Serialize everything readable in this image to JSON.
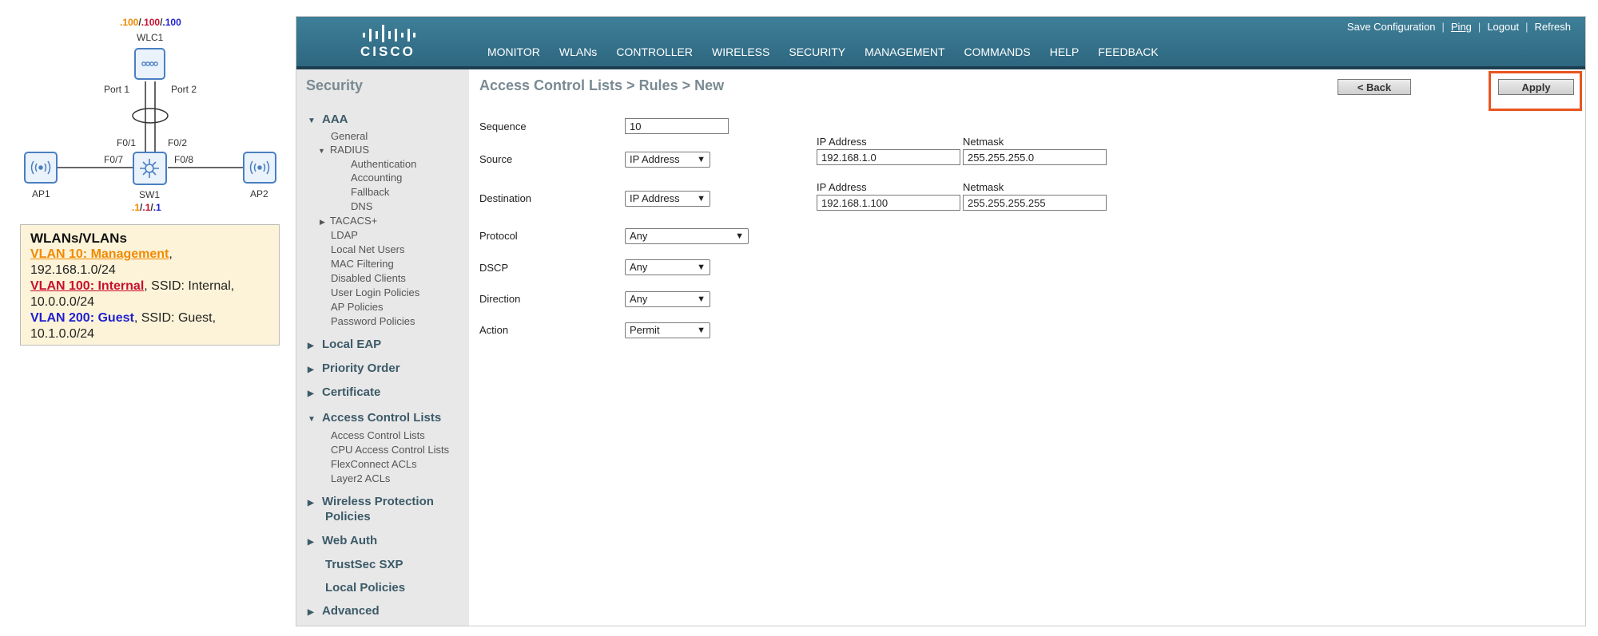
{
  "topology": {
    "wlc_ips": [
      ".100",
      "/",
      ".100",
      "/",
      ".100"
    ],
    "wlc_name": "WLC1",
    "port1": "Port 1",
    "port2": "Port 2",
    "f01": "F0/1",
    "f02": "F0/2",
    "f07": "F0/7",
    "f08": "F0/8",
    "ap1": "AP1",
    "ap2": "AP2",
    "sw_name": "SW1",
    "sw_ips": [
      ".1",
      "/",
      ".1",
      "/",
      ".1"
    ]
  },
  "legend": {
    "title": "WLANs/VLANs",
    "vlan10_name": "VLAN 10: Management",
    "vlan10_rest": ",",
    "vlan10_net": "192.168.1.0/24",
    "vlan100_name": "VLAN 100: Internal",
    "vlan100_rest": ", SSID: Internal,",
    "vlan100_net": "10.0.0.0/24",
    "vlan200_name": "VLAN 200: Guest",
    "vlan200_rest": ", SSID: Guest,",
    "vlan200_net": "10.1.0.0/24"
  },
  "header": {
    "logo_text": "CISCO",
    "toplinks": [
      "Save Configuration",
      "Ping",
      "Logout",
      "Refresh"
    ],
    "nav": [
      "MONITOR",
      "WLANs",
      "CONTROLLER",
      "WIRELESS",
      "SECURITY",
      "MANAGEMENT",
      "COMMANDS",
      "HELP",
      "FEEDBACK"
    ],
    "active_nav": "SECURITY",
    "accent": "#f7941d"
  },
  "sidebar": {
    "title": "Security",
    "aaa": "AAA",
    "aaa_items": [
      "General",
      "RADIUS"
    ],
    "radius_items": [
      "Authentication",
      "Accounting",
      "Fallback",
      "DNS"
    ],
    "tacacs": "TACACS+",
    "aaa_more": [
      "LDAP",
      "Local Net Users",
      "MAC Filtering",
      "Disabled Clients",
      "User Login Policies",
      "AP Policies",
      "Password Policies"
    ],
    "local_eap": "Local EAP",
    "priority_order": "Priority Order",
    "certificate": "Certificate",
    "acl": "Access Control Lists",
    "acl_items": [
      "Access Control Lists",
      "CPU Access Control Lists",
      "FlexConnect ACLs",
      "Layer2 ACLs"
    ],
    "wireless_protection_1": "Wireless Protection",
    "wireless_protection_2": "Policies",
    "web_auth": "Web Auth",
    "trustsec": "TrustSec SXP",
    "local_policies": "Local Policies",
    "advanced": "Advanced"
  },
  "content": {
    "breadcrumb": "Access Control Lists > Rules > New",
    "back_label": "< Back",
    "apply_label": "Apply",
    "highlight_color": "#e8551f",
    "labels": {
      "sequence": "Sequence",
      "source": "Source",
      "destination": "Destination",
      "protocol": "Protocol",
      "dscp": "DSCP",
      "direction": "Direction",
      "action": "Action"
    },
    "sequence_value": "10",
    "source_type": "IP Address",
    "destination_type": "IP Address",
    "protocol": "Any",
    "dscp": "Any",
    "direction": "Any",
    "action": "Permit",
    "ip_label": "IP Address",
    "netmask_label": "Netmask",
    "source_ip": "192.168.1.0",
    "source_mask": "255.255.255.0",
    "dest_ip": "192.168.1.100",
    "dest_mask": "255.255.255.255"
  }
}
